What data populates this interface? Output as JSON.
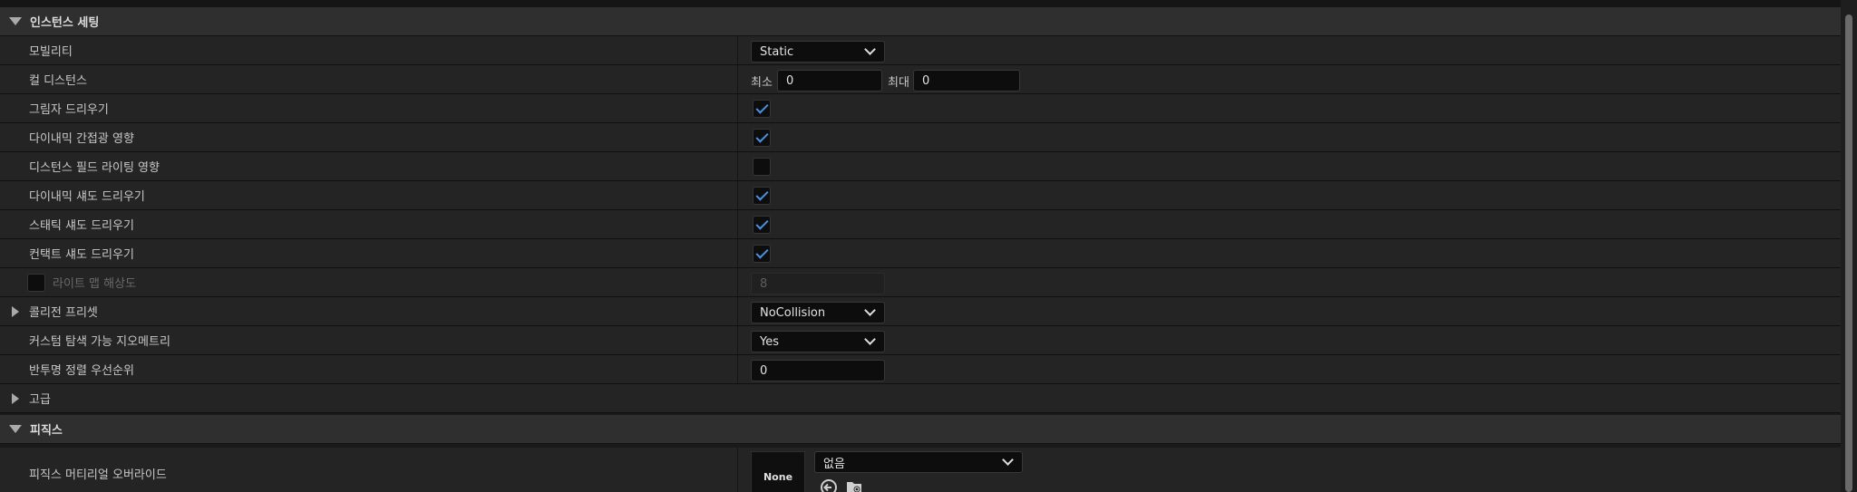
{
  "sections": {
    "instance": {
      "title": "인스턴스 세팅"
    },
    "physics": {
      "title": "피직스"
    }
  },
  "rows": {
    "mobility": {
      "label": "모빌리티",
      "value": "Static"
    },
    "cull_distance": {
      "label": "컬 디스턴스",
      "min_label": "최소",
      "min_value": "0",
      "max_label": "최대",
      "max_value": "0"
    },
    "cast_shadow": {
      "label": "그림자 드리우기",
      "checked": true
    },
    "affect_dynamic_indirect": {
      "label": "다이내믹 간접광 영향",
      "checked": true
    },
    "affect_distance_field": {
      "label": "디스턴스 필드 라이팅 영향",
      "checked": false
    },
    "cast_dynamic_shadow": {
      "label": "다이내믹 섀도 드리우기",
      "checked": true
    },
    "cast_static_shadow": {
      "label": "스태틱 섀도 드리우기",
      "checked": true
    },
    "cast_contact_shadow": {
      "label": "컨택트 섀도 드리우기",
      "checked": true
    },
    "lightmap_resolution": {
      "label": "라이트 맵 해상도",
      "value": "8",
      "override_checked": false
    },
    "collision_preset": {
      "label": "콜리전 프리셋",
      "value": "NoCollision"
    },
    "custom_navigable_geometry": {
      "label": "커스텀 탐색 가능 지오메트리",
      "value": "Yes"
    },
    "translucency_sort_priority": {
      "label": "반투명 정렬 우선순위",
      "value": "0"
    },
    "advanced": {
      "label": "고급"
    },
    "phys_material_override": {
      "label": "피직스 머티리얼 오버라이드",
      "thumbnail": "None",
      "value": "없음"
    }
  },
  "icons": {
    "expanded": "triangle-down-icon",
    "collapsed": "triangle-right-icon",
    "dropdown": "chevron-down-icon",
    "browse": "browse-arrow-icon",
    "folder": "folder-search-icon"
  },
  "colors": {
    "check": "#4d8fe0",
    "panel": "#242424",
    "header": "#2f2f2f"
  }
}
